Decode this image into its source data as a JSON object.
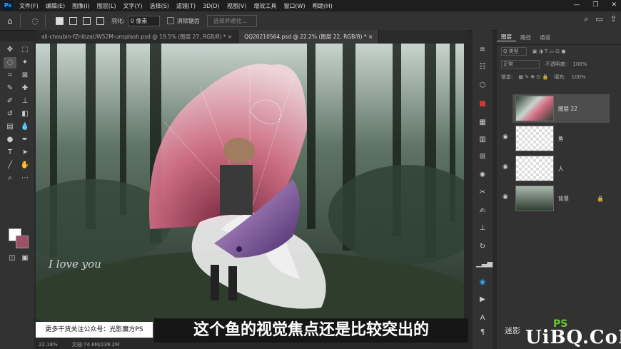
{
  "menubar": {
    "logo": "Ps",
    "items": [
      "文件(F)",
      "编辑(E)",
      "图像(I)",
      "图层(L)",
      "文字(Y)",
      "选择(S)",
      "滤镜(T)",
      "3D(D)",
      "视图(V)",
      "增效工具",
      "窗口(W)",
      "帮助(H)"
    ],
    "window_controls": [
      "—",
      "❐",
      "✕"
    ]
  },
  "options": {
    "feather_label": "羽化:",
    "feather_value": "0 像素",
    "antialias_label": "消除锯齿",
    "select_subject": "选择并遮住..."
  },
  "tabs": [
    {
      "label": "ali-choubin-fZnibzaUW52M-unsplash.psd @ 19.5% (图层 27, RGB/8) *",
      "close": "×"
    },
    {
      "label": "QQ20210564.psd @ 22.2% (图层 22, RGB/8) *",
      "close": "×"
    }
  ],
  "canvas": {
    "overlay_text": "I love you"
  },
  "status": {
    "zoom": "22.18%",
    "doc": "文档:74.6M/239.2M"
  },
  "layers_panel": {
    "tabs": [
      "图层",
      "路径",
      "通道"
    ],
    "filter_label": "Q 类型",
    "blend_mode": "正常",
    "opacity_label": "不透明度:",
    "opacity_value": "100%",
    "lock_label": "锁定:",
    "fill_label": "填充:",
    "fill_value": "100%",
    "layers": [
      {
        "name": "图层 22",
        "selected": true
      },
      {
        "name": "鱼",
        "selected": false
      },
      {
        "name": "人",
        "selected": false
      },
      {
        "name": "背景",
        "selected": false
      }
    ]
  },
  "subtitles": {
    "left": "更多干货关注公众号：光影魔方PS",
    "main": "这个鱼的视觉焦点还是比较突出的"
  },
  "watermark": {
    "prefix": "迷影",
    "brand": "UiBQ.CoM",
    "ps": "PS"
  },
  "colors": {
    "background_swatch": "#a05066",
    "foreground_swatch": "#ffffff"
  }
}
